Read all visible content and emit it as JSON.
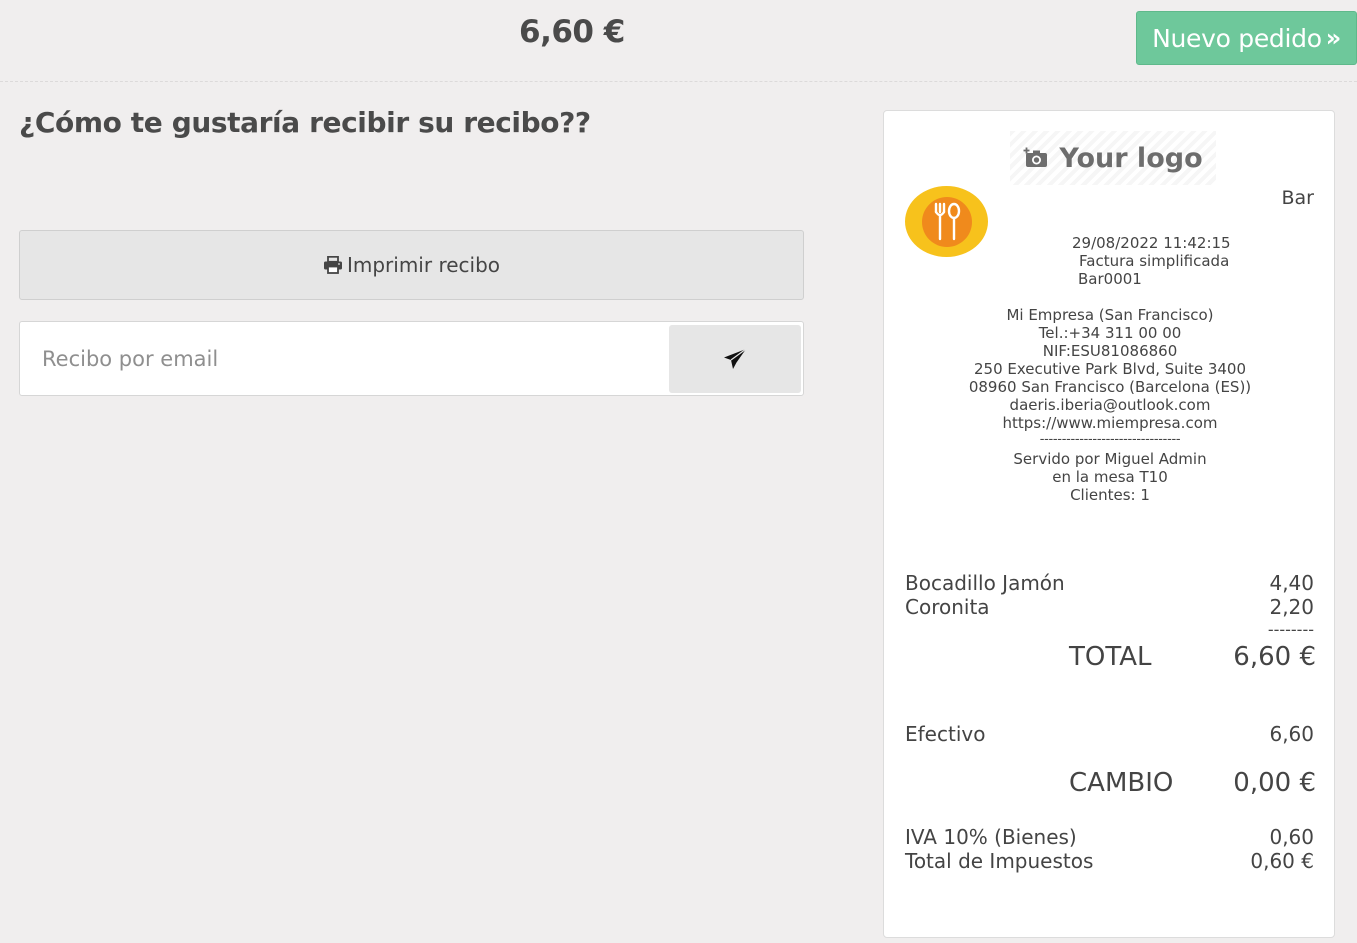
{
  "header": {
    "total": "6,60 €",
    "new_order_label": "Nuevo pedido",
    "new_order_chevron": "»"
  },
  "main": {
    "question": "¿Cómo te gustaría recibir su recibo??",
    "print_label": "Imprimir recibo",
    "email_placeholder": "Recibo por email",
    "email_value": ""
  },
  "receipt": {
    "logo_text": "Your logo",
    "shop_name": "Bar",
    "datetime": "29/08/2022 11:42:15",
    "doc_type": "Factura simplificada",
    "doc_number": "Bar0001",
    "company": "Mi Empresa (San Francisco)",
    "phone": "Tel.:+34 311 00 00",
    "nif": "NIF:ESU81086860",
    "address1": "250 Executive Park Blvd, Suite 3400",
    "address2": "08960 San Francisco (Barcelona (ES))",
    "email": "daeris.iberia@outlook.com",
    "website": "https://www.miempresa.com",
    "separator": "--------------------------------",
    "served_by": "Servido por Miguel Admin",
    "table": "en la mesa T10",
    "clients": "Clientes: 1",
    "items": [
      {
        "name": "Bocadillo Jamón",
        "price": "4,40"
      },
      {
        "name": "Coronita",
        "price": "2,20"
      }
    ],
    "short_separator": "--------",
    "total_label": "TOTAL",
    "total_value": "6,60 €",
    "payment_label": "Efectivo",
    "payment_value": "6,60",
    "change_label": "CAMBIO",
    "change_value": "0,00 €",
    "tax_label": "IVA 10% (Bienes)",
    "tax_value": "0,60",
    "tax_total_label": "Total de Impuestos",
    "tax_total_value": "0,60 €"
  },
  "colors": {
    "background": "#f0eeee",
    "accent_button": "#6ec89b",
    "logo_outer": "#f7c21c",
    "logo_inner": "#f08a1c"
  },
  "icons": {
    "new_order": "double-chevron-right-icon",
    "print": "printer-icon",
    "send": "paper-plane-icon",
    "logo": "camera-add-icon",
    "shop": "fork-spoon-icon"
  }
}
